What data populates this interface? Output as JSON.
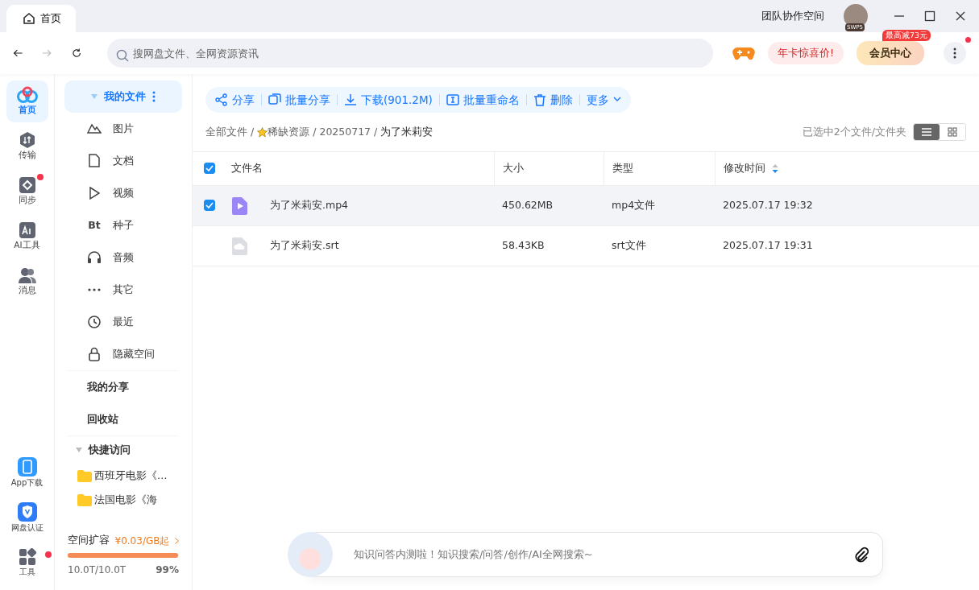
{
  "tabs": [
    {
      "label": "首页",
      "selected": true
    }
  ],
  "title_bar": {
    "team_space": "团队协作空间",
    "avatar_badge": "SWP5"
  },
  "search": {
    "placeholder": "搜网盘文件、全网资源资讯"
  },
  "promo": {
    "label": "年卡惊喜价!"
  },
  "vip": {
    "label": "会员中心",
    "badge": "最高减73元"
  },
  "rail": [
    {
      "label": "首页",
      "kind": "home",
      "selected": true,
      "notification": false
    },
    {
      "label": "传输",
      "kind": "transfer",
      "selected": false,
      "notification": false
    },
    {
      "label": "同步",
      "kind": "sync",
      "selected": false,
      "notification": true
    },
    {
      "label": "AI工具",
      "kind": "ai",
      "selected": false,
      "notification": false
    },
    {
      "label": "消息",
      "kind": "people",
      "selected": false,
      "notification": false
    }
  ],
  "rail_bottom": [
    {
      "label": "App下载",
      "kind": "phone",
      "notification": false
    },
    {
      "label": "网盘认证",
      "kind": "shield",
      "notification": false
    },
    {
      "label": "工具",
      "kind": "grid",
      "notification": true
    }
  ],
  "sidebar": {
    "my_files": {
      "label": "我的文件",
      "expanded": true
    },
    "categories": [
      {
        "label": "图片",
        "kind": "image"
      },
      {
        "label": "文档",
        "kind": "doc"
      },
      {
        "label": "视频",
        "kind": "video"
      },
      {
        "label": "种子",
        "kind": "bt",
        "icon_text": "Bt"
      },
      {
        "label": "音频",
        "kind": "audio"
      },
      {
        "label": "其它",
        "kind": "other"
      },
      {
        "label": "最近",
        "kind": "recent"
      },
      {
        "label": "隐藏空间",
        "kind": "lock"
      }
    ],
    "links": [
      "我的分享",
      "回收站"
    ],
    "quick_access": {
      "label": "快捷访问",
      "expanded": true,
      "items": [
        "西班牙电影《…",
        "法国电影《海"
      ]
    },
    "storage": {
      "title": "空间扩容",
      "price": "¥0.03/GB起",
      "level": 0.99,
      "used": "10.0T/10.0T",
      "percent": "99%"
    }
  },
  "toolbar": [
    {
      "label": "分享",
      "kind": "share"
    },
    {
      "label": "批量分享",
      "kind": "batch"
    },
    {
      "label": "下载(901.2M)",
      "kind": "download"
    },
    {
      "label": "批量重命名",
      "kind": "rename"
    },
    {
      "label": "删除",
      "kind": "delete"
    },
    {
      "label": "更多",
      "kind": "more"
    }
  ],
  "breadcrumb": [
    {
      "label": "全部文件",
      "starred": false
    },
    {
      "label": "稀缺资源",
      "starred": true
    },
    {
      "label": "20250717",
      "starred": false
    },
    {
      "label": "为了米莉安",
      "starred": false
    }
  ],
  "breadcrumb_separator": "/",
  "selection_info": "已选中2个文件/文件夹",
  "view_modes": [
    {
      "kind": "list",
      "selected": true
    },
    {
      "kind": "grid",
      "selected": false
    }
  ],
  "table": {
    "all_checked": true,
    "columns": [
      {
        "label": "文件名",
        "sorted": false
      },
      {
        "label": "大小",
        "sorted": false
      },
      {
        "label": "类型",
        "sorted": false
      },
      {
        "label": "修改时间",
        "sorted": true
      }
    ],
    "rows": [
      {
        "name": "为了米莉安.mp4",
        "size": "450.62MB",
        "type": "mp4文件",
        "modified": "2025.07.17 19:32",
        "kind": "video",
        "selected": true
      },
      {
        "name": "为了米莉安.srt",
        "size": "58.43KB",
        "type": "srt文件",
        "modified": "2025.07.17 19:31",
        "kind": "subtitle",
        "selected": false
      }
    ]
  },
  "assistant": {
    "placeholder": "知识问答内测啦！知识搜索/问答/创作/AI全网搜索~"
  }
}
